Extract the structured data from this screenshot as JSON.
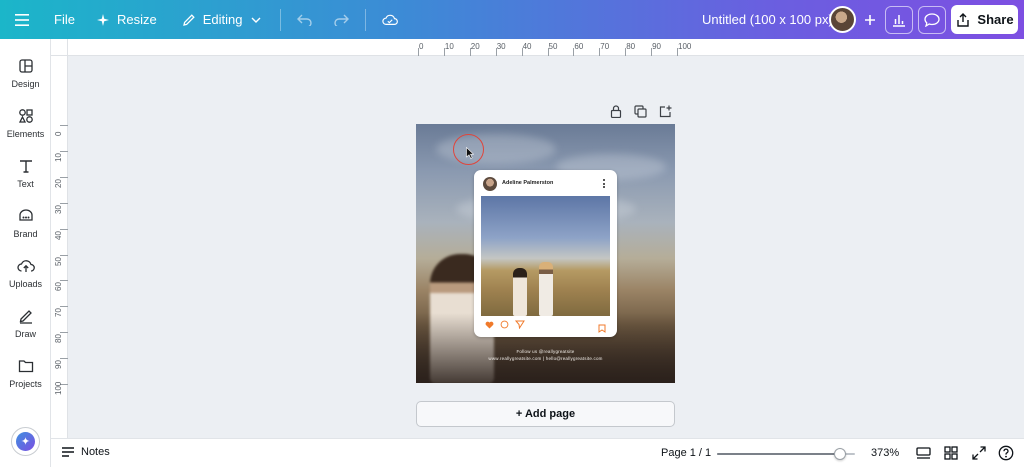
{
  "topbar": {
    "file_label": "File",
    "resize_label": "Resize",
    "editing_label": "Editing",
    "doc_title": "Untitled (100 x 100 px)",
    "share_label": "Share"
  },
  "sidebar": {
    "items": [
      {
        "label": "Design",
        "icon": "design-icon"
      },
      {
        "label": "Elements",
        "icon": "elements-icon"
      },
      {
        "label": "Text",
        "icon": "text-icon"
      },
      {
        "label": "Brand",
        "icon": "brand-icon"
      },
      {
        "label": "Uploads",
        "icon": "uploads-icon"
      },
      {
        "label": "Draw",
        "icon": "draw-icon"
      },
      {
        "label": "Projects",
        "icon": "projects-icon"
      }
    ]
  },
  "ruler": {
    "top_labels": [
      "0",
      "10",
      "20",
      "30",
      "40",
      "50",
      "60",
      "70",
      "80",
      "90",
      "100"
    ],
    "left_labels": [
      "0",
      "10",
      "20",
      "30",
      "40",
      "50",
      "60",
      "70",
      "80",
      "90",
      "100"
    ]
  },
  "design": {
    "post_name": "Adeline Palmerston",
    "follow_line1": "Follow us @reallygreatsite",
    "follow_line2": "www.reallygreatsite.com | hello@reallygreatsite.com"
  },
  "canvas": {
    "add_page_label": "+ Add page"
  },
  "bottombar": {
    "notes_label": "Notes",
    "page_label": "Page 1 / 1",
    "zoom_label": "373%",
    "zoom_fraction": 0.89
  },
  "colors": {
    "accent_start": "#1bb6c9",
    "accent_end": "#7d4fe2",
    "cursor_ring": "#e0453b",
    "heart": "#f07a2b"
  }
}
